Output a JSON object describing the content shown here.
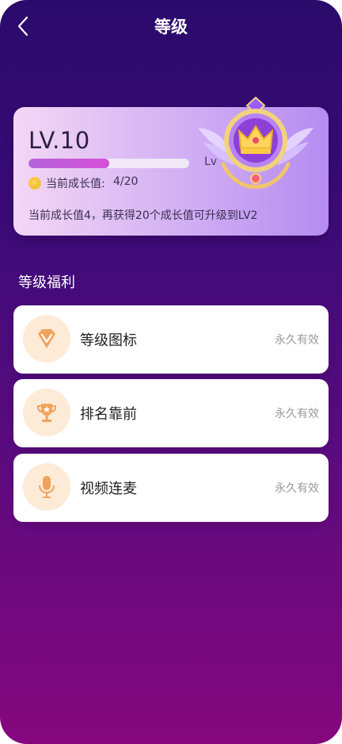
{
  "header": {
    "title": "等级"
  },
  "level_card": {
    "level": "LV.10",
    "progress_fraction": 0.5,
    "next_level_label": "Lv",
    "growth_label": "当前成长值:",
    "growth_value": "4/20",
    "tip": "当前成长值4，再获得20个成长值可升级到LV2"
  },
  "benefits_section": {
    "title": "等级福利",
    "items": [
      {
        "name": "等级图标",
        "status": "永久有效",
        "icon": "diamond-icon"
      },
      {
        "name": "排名靠前",
        "status": "永久有效",
        "icon": "trophy-icon"
      },
      {
        "name": "视频连麦",
        "status": "永久有效",
        "icon": "microphone-icon"
      }
    ]
  },
  "colors": {
    "accent": "#d64fd9",
    "icon_orange": "#f0a35a"
  }
}
